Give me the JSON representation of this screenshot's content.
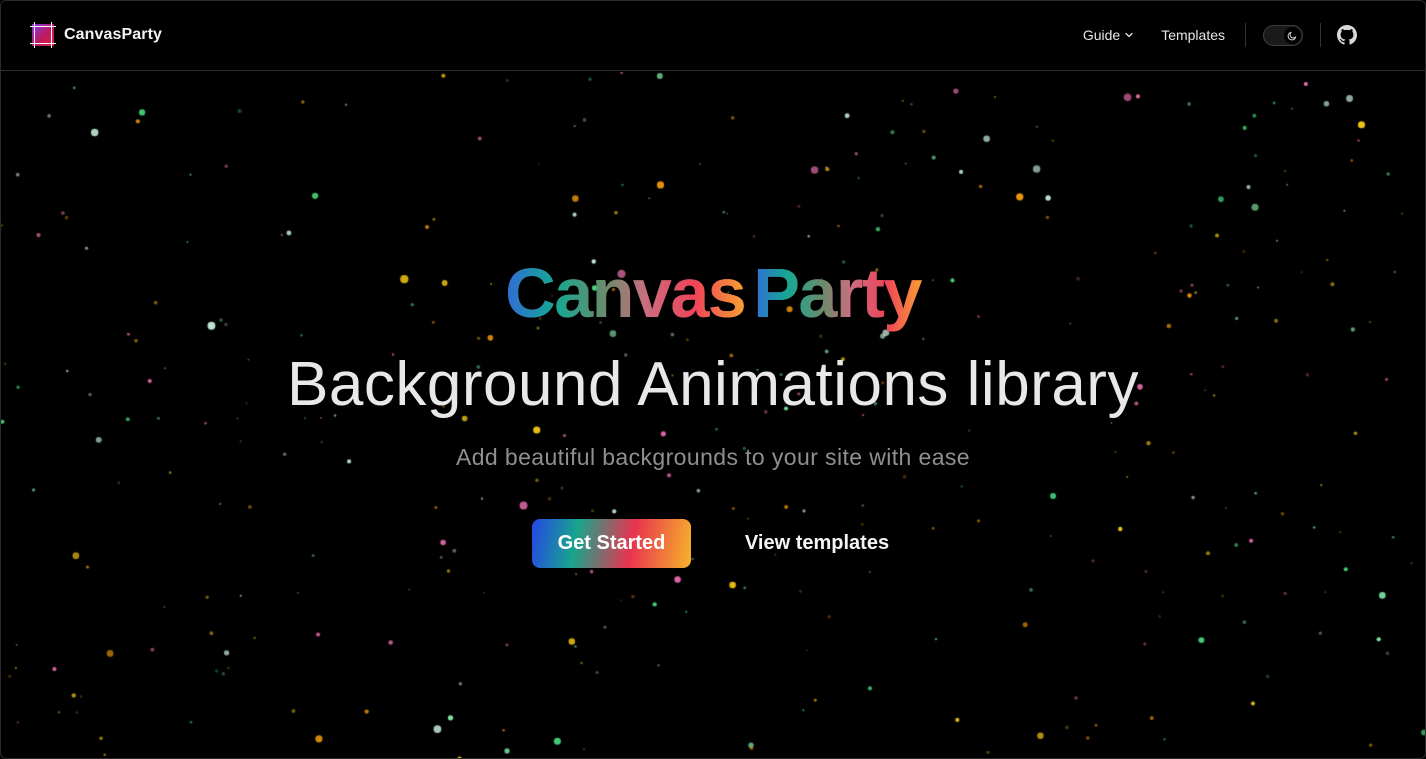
{
  "nav": {
    "brand": "CanvasParty",
    "guide_label": "Guide",
    "templates_label": "Templates",
    "theme_toggle_icon": "moon-icon",
    "github_icon": "github-icon"
  },
  "hero": {
    "brand_word_1": "Canvas",
    "brand_word_2": "Party",
    "headline": "Background Animations library",
    "subline": "Add beautiful backgrounds to your site with ease",
    "primary_cta": "Get Started",
    "secondary_cta": "View templates"
  },
  "colors": {
    "background": "#000000",
    "dot_palette": [
      "#4ade80",
      "#facc15",
      "#f472b6",
      "#d1fae5",
      "#f59e0b",
      "#86efac"
    ]
  }
}
